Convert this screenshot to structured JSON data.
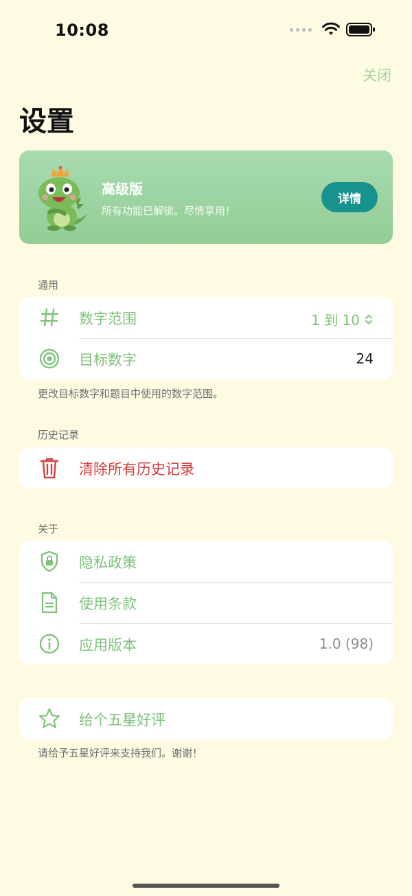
{
  "status_bar": {
    "time": "10:08"
  },
  "nav": {
    "close_label": "关闭",
    "title": "设置"
  },
  "premium": {
    "title": "高级版",
    "subtitle": "所有功能已解锁。尽情享用！",
    "button_label": "详情",
    "card_color": "#a8dbb0",
    "button_color": "#17928d"
  },
  "general": {
    "header": "通用",
    "rows": [
      {
        "icon": "hash-icon",
        "label": "数字范围",
        "value": "1 到 10"
      },
      {
        "icon": "target-icon",
        "label": "目标数字",
        "value": "24"
      }
    ],
    "footer": "更改目标数字和题目中使用的数字范围。"
  },
  "history": {
    "header": "历史记录",
    "rows": [
      {
        "icon": "trash-icon",
        "label": "清除所有历史记录"
      }
    ]
  },
  "about": {
    "header": "关于",
    "rows": [
      {
        "icon": "privacy-shield-icon",
        "label": "隐私政策"
      },
      {
        "icon": "document-icon",
        "label": "使用条款"
      },
      {
        "icon": "info-icon",
        "label": "应用版本",
        "value": "1.0 (98)"
      }
    ]
  },
  "rate": {
    "rows": [
      {
        "icon": "star-icon",
        "label": "给个五星好评"
      }
    ],
    "footer": "请给予五星好评来支持我们。谢谢！"
  },
  "colors": {
    "background": "#fefbe2",
    "accent_green": "#7ec47a",
    "danger_red": "#d93c3c",
    "teal": "#17928d"
  }
}
